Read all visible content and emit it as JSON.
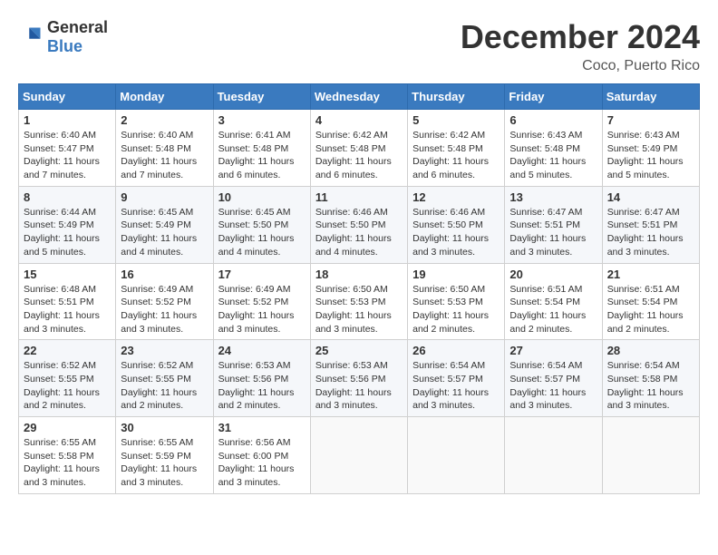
{
  "header": {
    "logo": {
      "text1": "General",
      "text2": "Blue"
    },
    "title": "December 2024",
    "location": "Coco, Puerto Rico"
  },
  "columns": [
    "Sunday",
    "Monday",
    "Tuesday",
    "Wednesday",
    "Thursday",
    "Friday",
    "Saturday"
  ],
  "weeks": [
    [
      {
        "day": "1",
        "sunrise": "6:40 AM",
        "sunset": "5:47 PM",
        "daylight": "11 hours and 7 minutes."
      },
      {
        "day": "2",
        "sunrise": "6:40 AM",
        "sunset": "5:48 PM",
        "daylight": "11 hours and 7 minutes."
      },
      {
        "day": "3",
        "sunrise": "6:41 AM",
        "sunset": "5:48 PM",
        "daylight": "11 hours and 6 minutes."
      },
      {
        "day": "4",
        "sunrise": "6:42 AM",
        "sunset": "5:48 PM",
        "daylight": "11 hours and 6 minutes."
      },
      {
        "day": "5",
        "sunrise": "6:42 AM",
        "sunset": "5:48 PM",
        "daylight": "11 hours and 6 minutes."
      },
      {
        "day": "6",
        "sunrise": "6:43 AM",
        "sunset": "5:48 PM",
        "daylight": "11 hours and 5 minutes."
      },
      {
        "day": "7",
        "sunrise": "6:43 AM",
        "sunset": "5:49 PM",
        "daylight": "11 hours and 5 minutes."
      }
    ],
    [
      {
        "day": "8",
        "sunrise": "6:44 AM",
        "sunset": "5:49 PM",
        "daylight": "11 hours and 5 minutes."
      },
      {
        "day": "9",
        "sunrise": "6:45 AM",
        "sunset": "5:49 PM",
        "daylight": "11 hours and 4 minutes."
      },
      {
        "day": "10",
        "sunrise": "6:45 AM",
        "sunset": "5:50 PM",
        "daylight": "11 hours and 4 minutes."
      },
      {
        "day": "11",
        "sunrise": "6:46 AM",
        "sunset": "5:50 PM",
        "daylight": "11 hours and 4 minutes."
      },
      {
        "day": "12",
        "sunrise": "6:46 AM",
        "sunset": "5:50 PM",
        "daylight": "11 hours and 3 minutes."
      },
      {
        "day": "13",
        "sunrise": "6:47 AM",
        "sunset": "5:51 PM",
        "daylight": "11 hours and 3 minutes."
      },
      {
        "day": "14",
        "sunrise": "6:47 AM",
        "sunset": "5:51 PM",
        "daylight": "11 hours and 3 minutes."
      }
    ],
    [
      {
        "day": "15",
        "sunrise": "6:48 AM",
        "sunset": "5:51 PM",
        "daylight": "11 hours and 3 minutes."
      },
      {
        "day": "16",
        "sunrise": "6:49 AM",
        "sunset": "5:52 PM",
        "daylight": "11 hours and 3 minutes."
      },
      {
        "day": "17",
        "sunrise": "6:49 AM",
        "sunset": "5:52 PM",
        "daylight": "11 hours and 3 minutes."
      },
      {
        "day": "18",
        "sunrise": "6:50 AM",
        "sunset": "5:53 PM",
        "daylight": "11 hours and 3 minutes."
      },
      {
        "day": "19",
        "sunrise": "6:50 AM",
        "sunset": "5:53 PM",
        "daylight": "11 hours and 2 minutes."
      },
      {
        "day": "20",
        "sunrise": "6:51 AM",
        "sunset": "5:54 PM",
        "daylight": "11 hours and 2 minutes."
      },
      {
        "day": "21",
        "sunrise": "6:51 AM",
        "sunset": "5:54 PM",
        "daylight": "11 hours and 2 minutes."
      }
    ],
    [
      {
        "day": "22",
        "sunrise": "6:52 AM",
        "sunset": "5:55 PM",
        "daylight": "11 hours and 2 minutes."
      },
      {
        "day": "23",
        "sunrise": "6:52 AM",
        "sunset": "5:55 PM",
        "daylight": "11 hours and 2 minutes."
      },
      {
        "day": "24",
        "sunrise": "6:53 AM",
        "sunset": "5:56 PM",
        "daylight": "11 hours and 2 minutes."
      },
      {
        "day": "25",
        "sunrise": "6:53 AM",
        "sunset": "5:56 PM",
        "daylight": "11 hours and 3 minutes."
      },
      {
        "day": "26",
        "sunrise": "6:54 AM",
        "sunset": "5:57 PM",
        "daylight": "11 hours and 3 minutes."
      },
      {
        "day": "27",
        "sunrise": "6:54 AM",
        "sunset": "5:57 PM",
        "daylight": "11 hours and 3 minutes."
      },
      {
        "day": "28",
        "sunrise": "6:54 AM",
        "sunset": "5:58 PM",
        "daylight": "11 hours and 3 minutes."
      }
    ],
    [
      {
        "day": "29",
        "sunrise": "6:55 AM",
        "sunset": "5:58 PM",
        "daylight": "11 hours and 3 minutes."
      },
      {
        "day": "30",
        "sunrise": "6:55 AM",
        "sunset": "5:59 PM",
        "daylight": "11 hours and 3 minutes."
      },
      {
        "day": "31",
        "sunrise": "6:56 AM",
        "sunset": "6:00 PM",
        "daylight": "11 hours and 3 minutes."
      },
      null,
      null,
      null,
      null
    ]
  ],
  "labels": {
    "sunrise": "Sunrise:",
    "sunset": "Sunset:",
    "daylight": "Daylight:"
  }
}
